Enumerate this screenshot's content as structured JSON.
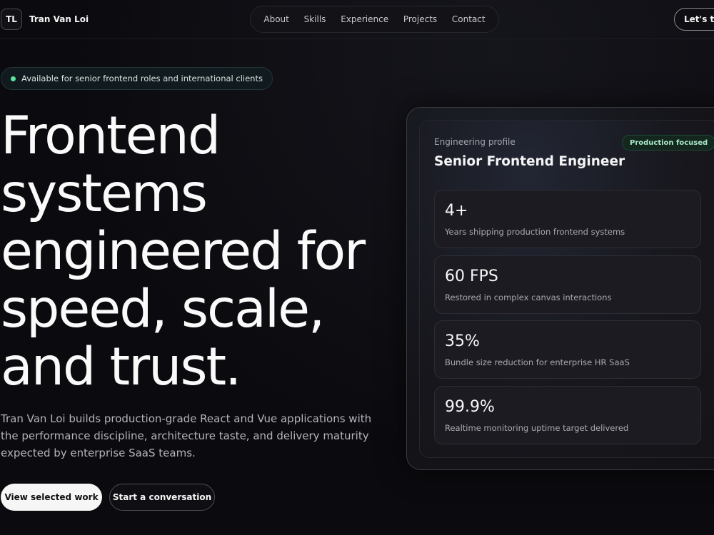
{
  "header": {
    "brand_initials": "TL",
    "brand_name": "Tran Van Loi",
    "nav": [
      "About",
      "Skills",
      "Experience",
      "Projects",
      "Contact"
    ],
    "cta": "Let's talk"
  },
  "availability": "Available for senior frontend roles and international clients",
  "hero": {
    "title_lines": [
      "Frontend",
      "systems",
      "engineered for",
      "speed, scale,",
      "and trust."
    ],
    "subtitle": "Tran Van Loi builds production-grade React and Vue applications with the performance discipline, architecture taste, and delivery maturity expected by enterprise SaaS teams.",
    "primary_button": "View selected work",
    "secondary_button": "Start a conversation"
  },
  "profile_card": {
    "eyebrow": "Engineering profile",
    "title": "Senior Frontend Engineer",
    "badge": "Production focused",
    "stats": [
      {
        "value": "4+",
        "label": "Years shipping production frontend systems"
      },
      {
        "value": "60 FPS",
        "label": "Restored in complex canvas interactions"
      },
      {
        "value": "35%",
        "label": "Bundle size reduction for enterprise HR SaaS"
      },
      {
        "value": "99.9%",
        "label": "Realtime monitoring uptime target delivered"
      }
    ]
  },
  "colors": {
    "background": "#0b0b0f",
    "accent_green": "#5be3a3",
    "text": "#f4f4f5"
  }
}
